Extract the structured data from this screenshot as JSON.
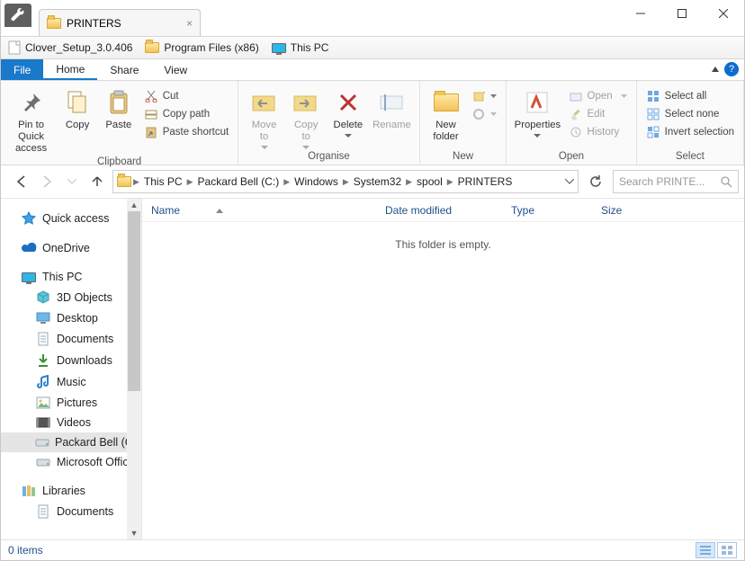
{
  "tab": {
    "title": "PRINTERS"
  },
  "bookmarks": [
    {
      "label": "Clover_Setup_3.0.406",
      "icon": "file"
    },
    {
      "label": "Program Files (x86)",
      "icon": "folder"
    },
    {
      "label": "This PC",
      "icon": "monitor"
    }
  ],
  "ribbonTabs": {
    "file": "File",
    "home": "Home",
    "share": "Share",
    "view": "View"
  },
  "ribbon": {
    "clipboard": {
      "title": "Clipboard",
      "pin": "Pin to Quick\naccess",
      "copy": "Copy",
      "paste": "Paste",
      "cut": "Cut",
      "copyPath": "Copy path",
      "pasteShortcut": "Paste shortcut"
    },
    "organise": {
      "title": "Organise",
      "moveTo": "Move\nto",
      "copyTo": "Copy\nto",
      "delete": "Delete",
      "rename": "Rename"
    },
    "new": {
      "title": "New",
      "newFolder": "New\nfolder"
    },
    "open": {
      "title": "Open",
      "properties": "Properties",
      "open": "Open",
      "edit": "Edit",
      "history": "History"
    },
    "select": {
      "title": "Select",
      "selectAll": "Select all",
      "selectNone": "Select none",
      "invert": "Invert selection"
    }
  },
  "breadcrumbs": [
    "This PC",
    "Packard Bell (C:)",
    "Windows",
    "System32",
    "spool",
    "PRINTERS"
  ],
  "search": {
    "placeholder": "Search PRINTE..."
  },
  "columns": {
    "name": "Name",
    "date": "Date modified",
    "type": "Type",
    "size": "Size"
  },
  "emptyMsg": "This folder is empty.",
  "tree": [
    {
      "label": "Quick access",
      "icon": "star",
      "indent": false
    },
    {
      "label": "OneDrive",
      "icon": "onedrive",
      "indent": false,
      "spacerBefore": true
    },
    {
      "label": "This PC",
      "icon": "monitor",
      "indent": false,
      "spacerBefore": true
    },
    {
      "label": "3D Objects",
      "icon": "cube",
      "indent": true
    },
    {
      "label": "Desktop",
      "icon": "desktop",
      "indent": true
    },
    {
      "label": "Documents",
      "icon": "doc",
      "indent": true
    },
    {
      "label": "Downloads",
      "icon": "download",
      "indent": true
    },
    {
      "label": "Music",
      "icon": "music",
      "indent": true
    },
    {
      "label": "Pictures",
      "icon": "picture",
      "indent": true
    },
    {
      "label": "Videos",
      "icon": "video",
      "indent": true
    },
    {
      "label": "Packard Bell (C:)",
      "icon": "drive",
      "indent": true,
      "selected": true
    },
    {
      "label": "Microsoft Office",
      "icon": "drive",
      "indent": true
    },
    {
      "label": "Libraries",
      "icon": "libraries",
      "indent": false,
      "spacerBefore": true
    },
    {
      "label": "Documents",
      "icon": "doc",
      "indent": true
    }
  ],
  "status": {
    "items": "0 items"
  }
}
